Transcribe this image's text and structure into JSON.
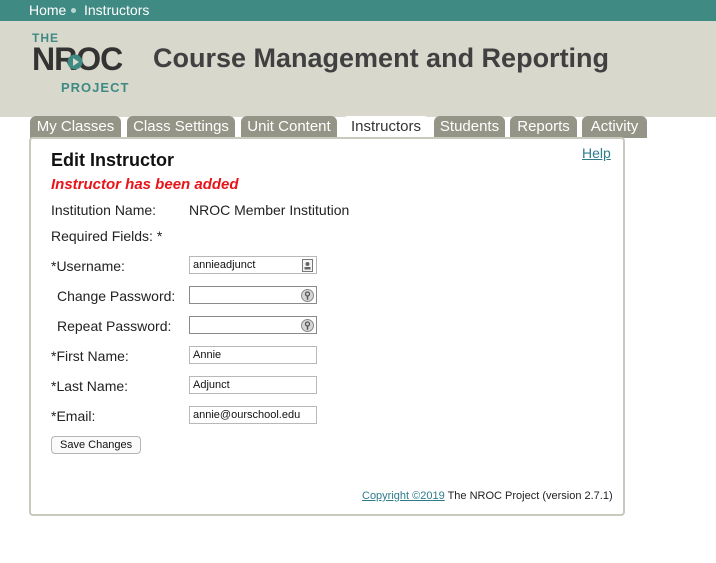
{
  "breadcrumb": {
    "home": "Home",
    "current": "Instructors"
  },
  "logo": {
    "the": "THE",
    "nroc": "NROC",
    "project": "PROJECT"
  },
  "app_title": "Course Management and Reporting",
  "tabs": [
    {
      "label": "My Classes",
      "active": false
    },
    {
      "label": "Class Settings",
      "active": false
    },
    {
      "label": "Unit Content",
      "active": false
    },
    {
      "label": "Instructors",
      "active": true
    },
    {
      "label": "Students",
      "active": false
    },
    {
      "label": "Reports",
      "active": false
    },
    {
      "label": "Activity",
      "active": false
    }
  ],
  "form": {
    "help": "Help",
    "heading": "Edit Instructor",
    "notice": "Instructor has been added",
    "institution_label": "Institution Name:",
    "institution_value": "NROC Member Institution",
    "required_label": "Required Fields: *",
    "username_label": "*Username:",
    "username_value": "annieadjunct",
    "change_password_label": "Change Password:",
    "change_password_value": "",
    "repeat_password_label": "Repeat Password:",
    "repeat_password_value": "",
    "first_name_label": "*First Name:",
    "first_name_value": "Annie",
    "last_name_label": "*Last Name:",
    "last_name_value": "Adjunct",
    "email_label": "*Email:",
    "email_value": "annie@ourschool.edu",
    "save_button": "Save Changes"
  },
  "footer": {
    "copyright_link": "Copyright ©2019",
    "rest": " The NROC Project (version 2.7.1)"
  },
  "colors": {
    "topbar": "#3f8a83",
    "header": "#d9d8cd",
    "tab": "#959587",
    "notice": "#e8141a",
    "link": "#2e7c8a"
  },
  "icons": {
    "username_field": "contact-card-icon",
    "password_field": "password-key-icon"
  }
}
